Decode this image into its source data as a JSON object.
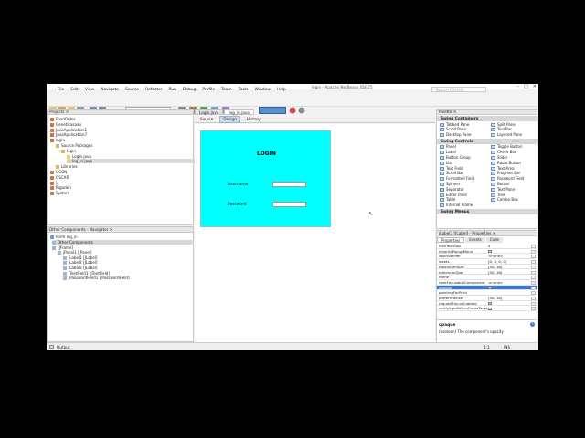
{
  "window": {
    "title": "login - Apache NetBeans IDE 25",
    "controls": [
      "–",
      "□",
      "✕"
    ]
  },
  "menu": [
    "File",
    "Edit",
    "View",
    "Navigate",
    "Source",
    "Refactor",
    "Run",
    "Debug",
    "Profile",
    "Team",
    "Tools",
    "Window",
    "Help"
  ],
  "search": {
    "placeholder": "Search (Ctrl+I)"
  },
  "toolbar": {
    "config": "<default config>",
    "icons": [
      "new-file-icon",
      "new-project-icon",
      "open-project-icon",
      "save-all-icon",
      "undo-icon",
      "redo-icon",
      "clean-build-icon",
      "build-icon",
      "run-icon",
      "debug-icon",
      "profile-icon"
    ]
  },
  "projects": {
    "title": "Projects",
    "items": [
      {
        "label": "FoodOrder",
        "level": 1
      },
      {
        "label": "Genetikasaan",
        "level": 1
      },
      {
        "label": "JavaApplication1",
        "level": 1
      },
      {
        "label": "JavaApplication7",
        "level": 1
      },
      {
        "label": "login",
        "level": 1
      },
      {
        "label": "Source Packages",
        "level": 2
      },
      {
        "label": "login",
        "level": 3
      },
      {
        "label": "Login.java",
        "level": 4
      },
      {
        "label": "log_in.java",
        "level": 4,
        "selected": true
      },
      {
        "label": "Libraries",
        "level": 2
      },
      {
        "label": "OCON",
        "level": 1
      },
      {
        "label": "OSCAR",
        "level": 1
      },
      {
        "label": "ir",
        "level": 1
      },
      {
        "label": "Rigodon",
        "level": 1
      },
      {
        "label": "System",
        "level": 1
      }
    ]
  },
  "navigator": {
    "title": "Other Components - Navigator",
    "form": "Form log_in",
    "items": [
      {
        "label": "Other Components",
        "level": 1,
        "selected": true
      },
      {
        "label": "[JFrame]",
        "level": 1
      },
      {
        "label": "jPanel1 [JPanel]",
        "level": 2
      },
      {
        "label": "jLabel1 [JLabel]",
        "level": 3
      },
      {
        "label": "jLabel2 [JLabel]",
        "level": 3
      },
      {
        "label": "jLabel3 [JLabel]",
        "level": 3
      },
      {
        "label": "jTextField1 [JTextField]",
        "level": 3
      },
      {
        "label": "jPasswordField1 [JPasswordField]",
        "level": 3
      }
    ]
  },
  "editor": {
    "tabs": [
      {
        "label": "Login.java",
        "active": false
      },
      {
        "label": "log_in.java",
        "active": true
      }
    ],
    "subtabs": [
      {
        "label": "Source",
        "active": false
      },
      {
        "label": "Design",
        "active": true
      },
      {
        "label": "History",
        "active": false
      }
    ]
  },
  "form": {
    "title": "LOGIN",
    "username_label": "Username",
    "password_label": "Password",
    "bg_color": "#00ffff"
  },
  "palette": {
    "title": "Palette",
    "categories": [
      {
        "name": "Swing Containers",
        "items": [
          "Tabbed Pane",
          "Split Pane",
          "Scroll Pane",
          "Tool Bar",
          "Desktop Pane",
          "Layered Pane"
        ]
      },
      {
        "name": "Swing Controls",
        "items": [
          "Panel",
          "Toggle Button",
          "Label",
          "Check Box",
          "Button Group",
          "Slider",
          "List",
          "Radio Button",
          "Text Field",
          "Text Area",
          "Scroll Bar",
          "Progress Bar",
          "Formatted Field",
          "Password Field",
          "Spinner",
          "Button",
          "Separator",
          "Text Pane",
          "Editor Pane",
          "Tree",
          "Table",
          "Combo Box",
          "Internal Frame"
        ]
      },
      {
        "name": "Swing Menus",
        "items": []
      }
    ]
  },
  "properties": {
    "title": "jLabel3 [JLabel] - Properties",
    "tabs": [
      "Properties",
      "Events",
      "Code"
    ],
    "rows": [
      {
        "name": "iconTextGap",
        "value": "4"
      },
      {
        "name": "inheritsPopupMenu",
        "value": "",
        "check": true
      },
      {
        "name": "inputVerifier",
        "value": "<none>"
      },
      {
        "name": "insets",
        "value": "[0, 0, 0, 0]"
      },
      {
        "name": "maximumSize",
        "value": "[50, 16]"
      },
      {
        "name": "minimumSize",
        "value": "[50, 16]"
      },
      {
        "name": "name",
        "value": ""
      },
      {
        "name": "nextFocusableComponent",
        "value": "<none>"
      },
      {
        "name": "opaque",
        "value": "",
        "check": true,
        "selected": true
      },
      {
        "name": "paintingForPrint",
        "value": ""
      },
      {
        "name": "preferredSize",
        "value": "[50, 16]"
      },
      {
        "name": "requestFocusEnabled",
        "value": "",
        "check": true
      },
      {
        "name": "verifyInputWhenFocusTarget",
        "value": "",
        "check": true
      }
    ],
    "description_title": "opaque",
    "description": "(boolean) The component's opacity"
  },
  "status": {
    "output": "Output",
    "position": "1:1",
    "mode": "INS"
  }
}
